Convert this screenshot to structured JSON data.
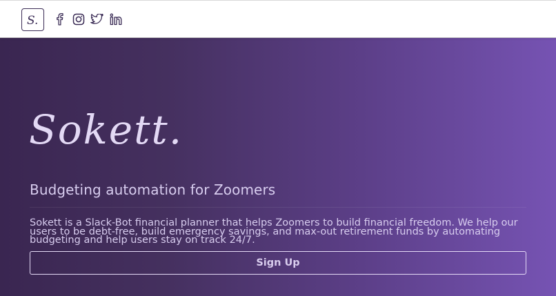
{
  "header": {
    "logo_text": "S.",
    "social_icons": [
      "facebook-icon",
      "instagram-icon",
      "twitter-icon",
      "linkedin-icon"
    ]
  },
  "hero": {
    "wordmark": "Sokett.",
    "tagline": "Budgeting automation for Zoomers",
    "description": "Sokett is a Slack-Bot financial planner that helps Zoomers to build financial freedom. We help our users to be debt-free, build emergency savings, and max-out retirement funds by automating budgeting and help users stay on track 24/7.",
    "cta_label": "Sign Up"
  },
  "colors": {
    "accent": "#3a2b55",
    "gradient_start": "#3a2651",
    "gradient_end": "#7653b3",
    "text_light": "#d8cdef"
  }
}
